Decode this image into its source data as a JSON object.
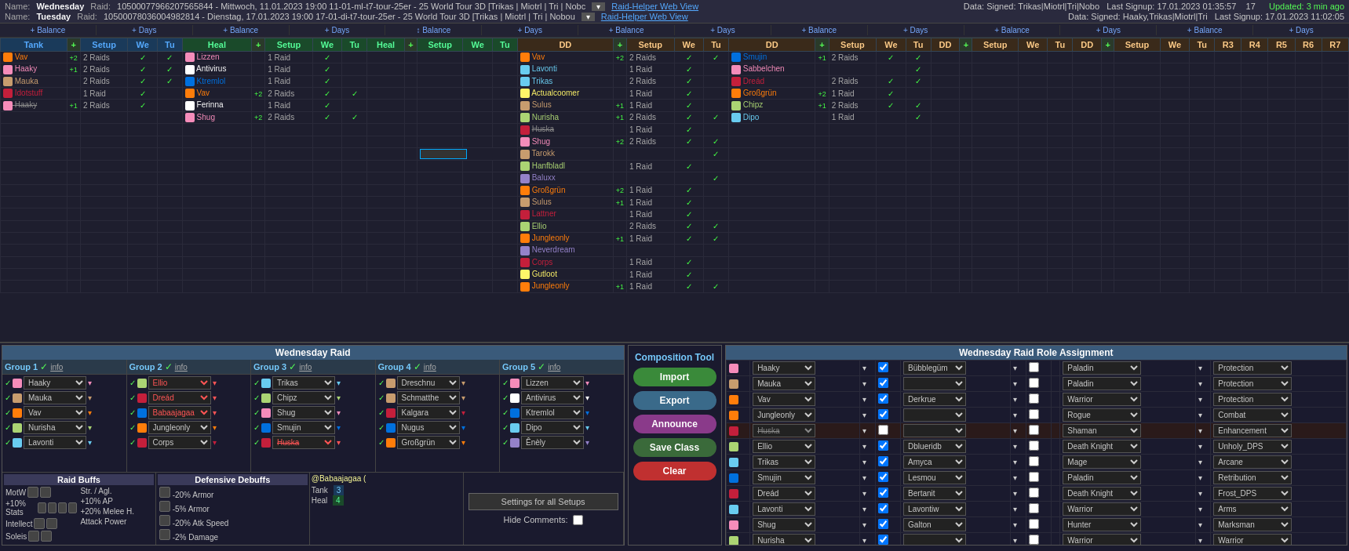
{
  "header": {
    "rows": [
      {
        "label": "Name:",
        "day": "Wednesday",
        "raid": "Raid:",
        "raidId": "10500077966207565844 - Mittwoch, 11.01.2023 19:00 11-01-ml-t7-tour-25er - 25 World Tour 3D [Trikas | Miotrl | Tri | Nobc",
        "link": "Raid-Helper Web View",
        "dataLabel": "Data:",
        "dataVal": "Signed: Trikas|Miotrl|Tri|Nobo",
        "lastSignup": "Last Signup: 17.01.2023 01:35:57",
        "count": "17"
      },
      {
        "label": "Name:",
        "day": "Tuesday",
        "raid": "Raid:",
        "raidId": "10500078036004982814 - Dienstag, 17.01.2023 19:00 17-01-di-t7-tour-25er - 25 World Tour 3D [Trikas | Miotrl | Tri | Nobou",
        "link": "Raid-Helper Web View",
        "dataLabel": "Data:",
        "dataVal": "Signed: Haaky,Trikas|Miotrl|Tri",
        "lastSignup": "Last Signup: 17.01.2023 11:02:05",
        "count": ""
      }
    ],
    "updated": "Updated: 3 min ago"
  },
  "balance": {
    "cells": [
      "+ Balance",
      "+ Days",
      "+ Balance",
      "+ Days",
      "+ Balance",
      "+ Days",
      "+ Balance",
      "+ Days",
      "+ Balance",
      "+ Days",
      "+ Balance",
      "+ Days",
      "+ Balance",
      "+ Days"
    ]
  },
  "raidTable": {
    "columns": [
      {
        "name": "Tank",
        "type": "tank"
      },
      {
        "name": "Heal",
        "type": "heal"
      },
      {
        "name": "Heal",
        "type": "heal"
      },
      {
        "name": "DD",
        "type": "dd"
      },
      {
        "name": "DD",
        "type": "dd"
      },
      {
        "name": "DD",
        "type": "dd"
      },
      {
        "name": "DD",
        "type": "dd"
      }
    ],
    "tankPlayers": [
      {
        "name": "Vav",
        "color": "c-druid",
        "plus": "+2",
        "raids": "2 Raids"
      },
      {
        "name": "Haaky",
        "color": "c-paladin",
        "plus": "+1",
        "raids": "2 Raids"
      },
      {
        "name": "Mauka",
        "color": "c-warrior",
        "plus": "",
        "raids": "2 Raids"
      },
      {
        "name": "Idotstuff",
        "color": "c-dk",
        "plus": "",
        "raids": "1 Raid"
      },
      {
        "name": "Haaky",
        "color": "c-paladin",
        "plus": "+1",
        "raids": "2 Raids",
        "strike": true
      }
    ],
    "heal1Players": [
      {
        "name": "Lizzen",
        "color": "c-paladin",
        "plus": "",
        "raids": "1 Raid"
      },
      {
        "name": "Antivirus",
        "color": "c-priest",
        "plus": "",
        "raids": "1 Raid"
      },
      {
        "name": "Ktremlol",
        "color": "c-shaman",
        "plus": "",
        "raids": "1 Raid"
      },
      {
        "name": "Vav",
        "color": "c-druid",
        "plus": "+2",
        "raids": "2 Raids"
      },
      {
        "name": "Ferinna",
        "color": "c-priest",
        "plus": "",
        "raids": "1 Raid"
      },
      {
        "name": "Shug",
        "color": "c-paladin",
        "plus": "+2",
        "raids": "2 Raids"
      }
    ],
    "ddPlayers1": [
      {
        "name": "Vav",
        "color": "c-druid",
        "plus": "+2",
        "raids": "2 Raids"
      },
      {
        "name": "Lavonti",
        "color": "c-mage",
        "plus": "",
        "raids": "1 Raid"
      },
      {
        "name": "Trikas",
        "color": "c-mage",
        "plus": "",
        "raids": "2 Raids"
      },
      {
        "name": "Actualcoomer",
        "color": "c-rogue",
        "plus": "",
        "raids": "1 Raid"
      },
      {
        "name": "Sulus",
        "color": "c-warrior",
        "plus": "+1",
        "raids": "1 Raid"
      },
      {
        "name": "Nurisha",
        "color": "c-hunter",
        "plus": "+1",
        "raids": "2 Raids"
      },
      {
        "name": "Huska",
        "color": "c-dk",
        "plus": "",
        "raids": "1 Raid",
        "strike": true
      },
      {
        "name": "Shug",
        "color": "c-paladin",
        "plus": "+2",
        "raids": "2 Raids"
      },
      {
        "name": "Tarokk",
        "color": "c-warrior",
        "plus": "",
        "raids": ""
      },
      {
        "name": "Hanfbladl",
        "color": "c-hunter",
        "plus": "",
        "raids": "1 Raid"
      },
      {
        "name": "Baluxx",
        "color": "c-warlock",
        "plus": "",
        "raids": ""
      },
      {
        "name": "Großgrün",
        "color": "c-druid",
        "plus": "+2",
        "raids": "1 Raid"
      },
      {
        "name": "Sulus",
        "color": "c-warrior",
        "plus": "+1",
        "raids": "1 Raid"
      },
      {
        "name": "Lattner",
        "color": "c-dk",
        "plus": "",
        "raids": "1 Raid"
      },
      {
        "name": "Ellio",
        "color": "c-hunter",
        "plus": "",
        "raids": "2 Raids"
      },
      {
        "name": "Jungleonly",
        "color": "c-druid",
        "plus": "+1",
        "raids": "1 Raid"
      },
      {
        "name": "Neverdream",
        "color": "c-warlock",
        "plus": "",
        "raids": ""
      },
      {
        "name": "Corps",
        "color": "c-dk",
        "plus": "",
        "raids": "1 Raid"
      },
      {
        "name": "Gutloot",
        "color": "c-rogue",
        "plus": "",
        "raids": "1 Raid"
      },
      {
        "name": "Jungleonly",
        "color": "c-druid",
        "plus": "+1",
        "raids": "1 Raid"
      }
    ],
    "ddPlayers2": [
      {
        "name": "Smujin",
        "color": "c-shaman",
        "plus": "+1",
        "raids": "2 Raids"
      },
      {
        "name": "Sabbelchen",
        "color": "c-paladin",
        "plus": "",
        "raids": ""
      },
      {
        "name": "Dreád",
        "color": "c-dk",
        "plus": "",
        "raids": "2 Raids"
      },
      {
        "name": "Großgrün",
        "color": "c-druid",
        "plus": "+2",
        "raids": "1 Raid"
      },
      {
        "name": "Chipz",
        "color": "c-hunter",
        "plus": "+1",
        "raids": "2 Raids"
      },
      {
        "name": "Dipo",
        "color": "c-mage",
        "plus": "",
        "raids": "1 Raid"
      }
    ]
  },
  "wednesdayRaid": {
    "title": "Wednesday Raid",
    "groups": [
      {
        "name": "Group 1",
        "players": [
          {
            "name": "Haaky",
            "color": "c-paladin"
          },
          {
            "name": "Mauka",
            "color": "c-warrior"
          },
          {
            "name": "Vav",
            "color": "c-druid"
          },
          {
            "name": "Nurisha",
            "color": "c-hunter"
          },
          {
            "name": "Lavonti",
            "color": "c-mage"
          }
        ]
      },
      {
        "name": "Group 2",
        "players": [
          {
            "name": "Ellio",
            "color": "c-hunter",
            "red": true
          },
          {
            "name": "Dreád",
            "color": "c-dk",
            "red": true
          },
          {
            "name": "Babaajagaa",
            "color": "c-shaman",
            "red": true
          },
          {
            "name": "Jungleonly",
            "color": "c-druid"
          },
          {
            "name": "Corps",
            "color": "c-dk"
          }
        ]
      },
      {
        "name": "Group 3",
        "players": [
          {
            "name": "Trikas",
            "color": "c-mage"
          },
          {
            "name": "Chipz",
            "color": "c-hunter"
          },
          {
            "name": "Shug",
            "color": "c-paladin"
          },
          {
            "name": "Smujin",
            "color": "c-shaman"
          },
          {
            "name": "Huska",
            "color": "c-dk",
            "red": true
          }
        ]
      },
      {
        "name": "Group 4",
        "players": [
          {
            "name": "Dreschnu",
            "color": "c-warrior"
          },
          {
            "name": "Schmatthe",
            "color": "c-warrior"
          },
          {
            "name": "Kalgara",
            "color": "c-dk"
          },
          {
            "name": "Nugus",
            "color": "c-shaman"
          },
          {
            "name": "Großgrün",
            "color": "c-druid"
          }
        ]
      },
      {
        "name": "Group 5",
        "players": [
          {
            "name": "Lizzen",
            "color": "c-paladin"
          },
          {
            "name": "Antivirus",
            "color": "c-priest"
          },
          {
            "name": "Ktremlol",
            "color": "c-shaman"
          },
          {
            "name": "Dipo",
            "color": "c-mage"
          },
          {
            "name": "Ênèly",
            "color": "c-warlock"
          }
        ]
      }
    ]
  },
  "compositionTool": {
    "title": "Composition Tool",
    "importLabel": "Import",
    "exportLabel": "Export",
    "announceLabel": "Announce",
    "saveClassLabel": "Save Class",
    "clearLabel": "Clear"
  },
  "roleAssignment": {
    "title": "Wednesday Raid Role Assignment",
    "rows": [
      {
        "player": "Haaky",
        "playerColor": "c-paladin",
        "role2": "Bübblegüm",
        "class": "Paladin",
        "spec": "Protection",
        "specColor": "spec-color-paladin"
      },
      {
        "player": "Mauka",
        "playerColor": "c-warrior",
        "role2": "",
        "class": "Paladin",
        "spec": "Protection",
        "specColor": "spec-color-paladin"
      },
      {
        "player": "Vav",
        "playerColor": "c-druid",
        "role2": "Derkrue",
        "class": "Warrior",
        "spec": "Protection",
        "specColor": "spec-color-warrior"
      },
      {
        "player": "Jungleonly",
        "playerColor": "c-druid",
        "role2": "",
        "class": "Rogue",
        "spec": "Combat",
        "specColor": "spec-color-rogue"
      },
      {
        "player": "Huska",
        "playerColor": "c-dk",
        "role2": "",
        "class": "Shaman",
        "spec": "Enhancement",
        "specColor": "spec-color-shaman",
        "strike": true
      },
      {
        "player": "Ellio",
        "playerColor": "c-hunter",
        "role2": "Dblueridb",
        "class": "Death Knight",
        "spec": "Unholy_DPS",
        "specColor": "spec-color-dk"
      },
      {
        "player": "Trikas",
        "playerColor": "c-mage",
        "role2": "Amyca",
        "class": "Mage",
        "spec": "Arcane",
        "specColor": "spec-color-mage"
      },
      {
        "player": "Smujin",
        "playerColor": "c-shaman",
        "role2": "Lesmou",
        "class": "Paladin",
        "spec": "Retribution",
        "specColor": "spec-color-paladin"
      },
      {
        "player": "Dreád",
        "playerColor": "c-dk",
        "role2": "Bertanit",
        "class": "Death Knight",
        "spec": "Frost_DPS",
        "specColor": "spec-color-dk"
      },
      {
        "player": "Lavonti",
        "playerColor": "c-mage",
        "role2": "Lavontiw",
        "class": "Warrior",
        "spec": "Arms",
        "specColor": "spec-color-warrior"
      },
      {
        "player": "Shug",
        "playerColor": "c-paladin",
        "role2": "Galton",
        "class": "Hunter",
        "spec": "Marksman",
        "specColor": "spec-color-hunter"
      },
      {
        "player": "Nurisha",
        "playerColor": "c-hunter",
        "role2": "",
        "class": "Warrior",
        "spec": "Warrior",
        "specColor": "spec-color-warrior"
      }
    ]
  },
  "raidBuffs": {
    "title": "Raid Buffs",
    "buffs": [
      {
        "name": "MotW",
        "icons": 2
      },
      {
        "name": "+10% Stats",
        "icons": 4
      },
      {
        "name": "Intellect",
        "icons": 2
      },
      {
        "name": "Soleis",
        "icons": 2
      }
    ],
    "col2": [
      {
        "name": "Str. / Agl."
      },
      {
        "name": "+10% AP"
      },
      {
        "name": "+20% Melee H."
      },
      {
        "name": "Attack Power"
      }
    ]
  },
  "defensiveDebuffs": {
    "title": "Defensive Debuffs",
    "items": [
      {
        "name": "-20% Armor",
        "icons": 1
      },
      {
        "name": "-5% Armor",
        "icons": 1
      },
      {
        "name": "-20% Atk Speed",
        "icons": 1
      },
      {
        "name": "-2% Damage",
        "icons": 1
      }
    ],
    "atSymbol": "@Babaajagaa ("
  },
  "tankHeal": {
    "tank": "3",
    "heal": "4"
  },
  "settings": {
    "settingsBtn": "Settings for all Setups",
    "hideComments": "Hide Comments:"
  }
}
